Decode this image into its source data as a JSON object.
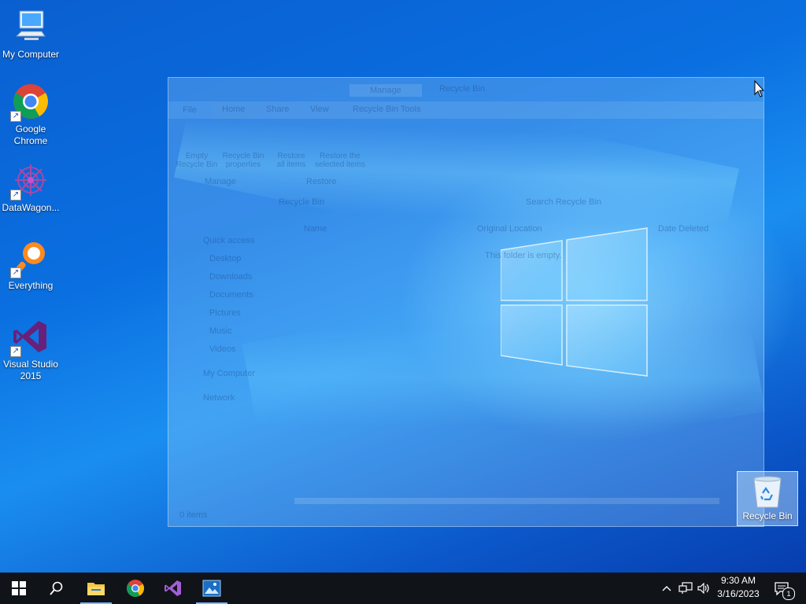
{
  "desktop": {
    "icons": [
      {
        "label": "My Computer",
        "icon": "computer-icon",
        "shortcut": false
      },
      {
        "label": "Google Chrome",
        "icon": "chrome-icon",
        "shortcut": true
      },
      {
        "label": "DataWagon...",
        "icon": "datawagon-icon",
        "shortcut": true
      },
      {
        "label": "Everything",
        "icon": "everything-search-icon",
        "shortcut": true
      },
      {
        "label": "Visual Studio 2015",
        "icon": "visual-studio-icon",
        "shortcut": true
      }
    ],
    "recycle_bin": {
      "label": "Recycle Bin",
      "icon": "recycle-bin-icon",
      "selected": true
    }
  },
  "ghost_window": {
    "title": "Recycle Bin",
    "contextual_tab": "Manage",
    "tabs": [
      "File",
      "Home",
      "Share",
      "View",
      "Recycle Bin Tools"
    ],
    "ribbon_buttons": [
      "Empty Recycle Bin",
      "Recycle Bin properties",
      "Restore all items",
      "Restore the selected items"
    ],
    "ribbon_groups": [
      "Manage",
      "Restore"
    ],
    "address": "Recycle Bin",
    "search_placeholder": "Search Recycle Bin",
    "nav": {
      "quick_access": "Quick access",
      "items": [
        "Desktop",
        "Downloads",
        "Documents",
        "Pictures",
        "Music",
        "Videos"
      ],
      "my_computer": "My Computer",
      "network": "Network"
    },
    "columns": [
      "Name",
      "Original Location",
      "Date Deleted"
    ],
    "empty_message": "This folder is empty.",
    "status": "0 items"
  },
  "taskbar": {
    "pinned": [
      {
        "name": "start-button",
        "icon": "windows-icon"
      },
      {
        "name": "search-button",
        "icon": "search-icon"
      },
      {
        "name": "file-explorer-button",
        "icon": "folder-icon",
        "active": true
      },
      {
        "name": "chrome-taskbar-button",
        "icon": "chrome-icon"
      },
      {
        "name": "visual-studio-taskbar-button",
        "icon": "visual-studio-icon"
      },
      {
        "name": "photos-taskbar-button",
        "icon": "photos-icon",
        "active": true
      }
    ],
    "time": "9:30 AM",
    "date": "3/16/2023",
    "notification_count": "1"
  }
}
